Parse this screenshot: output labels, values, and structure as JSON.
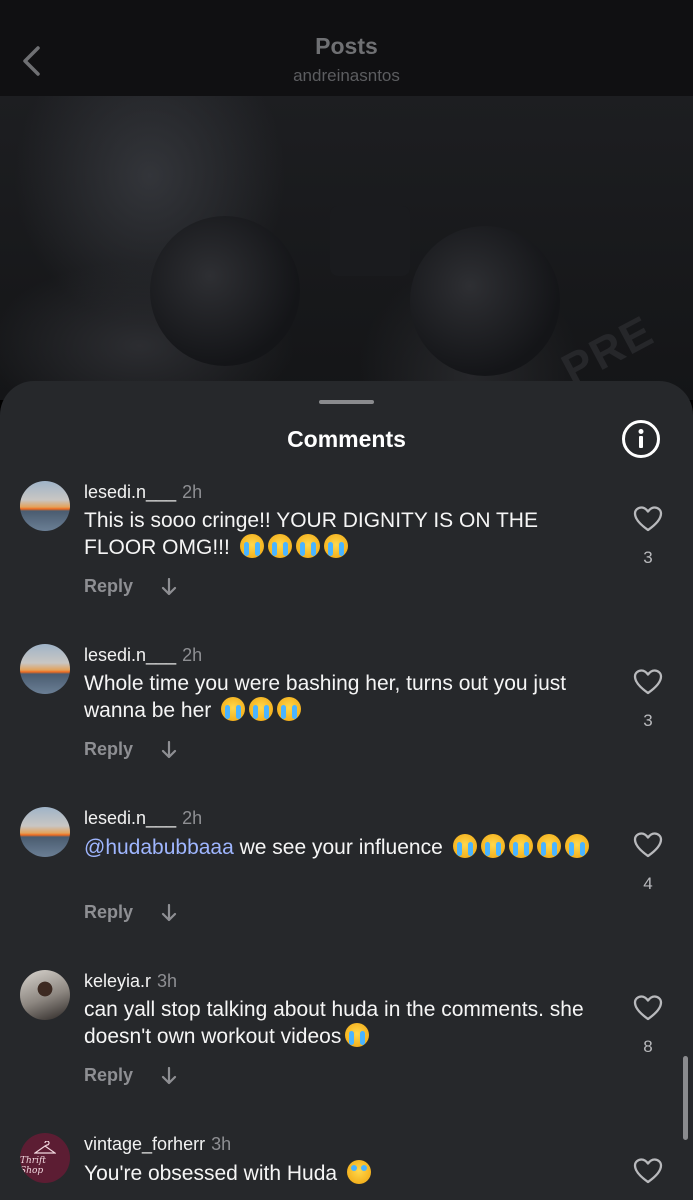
{
  "header": {
    "title": "Posts",
    "subtitle": "andreinasntos"
  },
  "photo": {
    "plate_text": "PRE"
  },
  "sheet": {
    "title": "Comments"
  },
  "comments": [
    {
      "user": "lesedi.n___",
      "time": "2h",
      "text": "This is sooo cringe!! YOUR DIGNITY IS ON THE FLOOR OMG!!!",
      "likes": "3",
      "reply": "Reply"
    },
    {
      "user": "lesedi.n___",
      "time": "2h",
      "text": "Whole time you were bashing her, turns out you just wanna be her",
      "likes": "3",
      "reply": "Reply"
    },
    {
      "user": "lesedi.n___",
      "time": "2h",
      "mention": "@hudabubbaaa",
      "text": " we see your influence",
      "likes": "4",
      "reply": "Reply"
    },
    {
      "user": "keleyia.r",
      "time": "3h",
      "text": "can yall stop talking about huda in the comments. she doesn't own workout videos",
      "likes": "8",
      "reply": "Reply"
    },
    {
      "user": "vintage_forherr",
      "time": "3h",
      "text": "You're obsessed with Huda",
      "avatar_text": "Thrift Shop"
    }
  ]
}
